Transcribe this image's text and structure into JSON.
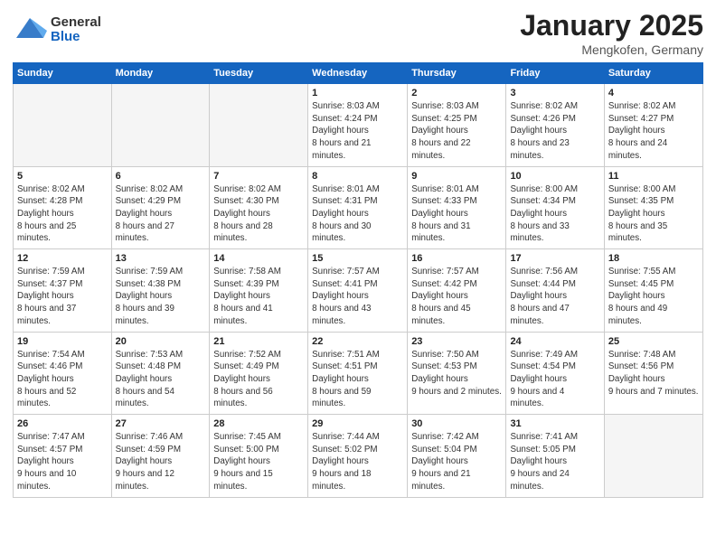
{
  "header": {
    "logo_general": "General",
    "logo_blue": "Blue",
    "title": "January 2025",
    "location": "Mengkofen, Germany"
  },
  "weekdays": [
    "Sunday",
    "Monday",
    "Tuesday",
    "Wednesday",
    "Thursday",
    "Friday",
    "Saturday"
  ],
  "weeks": [
    [
      {
        "day": "",
        "empty": true
      },
      {
        "day": "",
        "empty": true
      },
      {
        "day": "",
        "empty": true
      },
      {
        "day": "1",
        "sunrise": "8:03 AM",
        "sunset": "4:24 PM",
        "daylight": "8 hours and 21 minutes."
      },
      {
        "day": "2",
        "sunrise": "8:03 AM",
        "sunset": "4:25 PM",
        "daylight": "8 hours and 22 minutes."
      },
      {
        "day": "3",
        "sunrise": "8:02 AM",
        "sunset": "4:26 PM",
        "daylight": "8 hours and 23 minutes."
      },
      {
        "day": "4",
        "sunrise": "8:02 AM",
        "sunset": "4:27 PM",
        "daylight": "8 hours and 24 minutes."
      }
    ],
    [
      {
        "day": "5",
        "sunrise": "8:02 AM",
        "sunset": "4:28 PM",
        "daylight": "8 hours and 25 minutes."
      },
      {
        "day": "6",
        "sunrise": "8:02 AM",
        "sunset": "4:29 PM",
        "daylight": "8 hours and 27 minutes."
      },
      {
        "day": "7",
        "sunrise": "8:02 AM",
        "sunset": "4:30 PM",
        "daylight": "8 hours and 28 minutes."
      },
      {
        "day": "8",
        "sunrise": "8:01 AM",
        "sunset": "4:31 PM",
        "daylight": "8 hours and 30 minutes."
      },
      {
        "day": "9",
        "sunrise": "8:01 AM",
        "sunset": "4:33 PM",
        "daylight": "8 hours and 31 minutes."
      },
      {
        "day": "10",
        "sunrise": "8:00 AM",
        "sunset": "4:34 PM",
        "daylight": "8 hours and 33 minutes."
      },
      {
        "day": "11",
        "sunrise": "8:00 AM",
        "sunset": "4:35 PM",
        "daylight": "8 hours and 35 minutes."
      }
    ],
    [
      {
        "day": "12",
        "sunrise": "7:59 AM",
        "sunset": "4:37 PM",
        "daylight": "8 hours and 37 minutes."
      },
      {
        "day": "13",
        "sunrise": "7:59 AM",
        "sunset": "4:38 PM",
        "daylight": "8 hours and 39 minutes."
      },
      {
        "day": "14",
        "sunrise": "7:58 AM",
        "sunset": "4:39 PM",
        "daylight": "8 hours and 41 minutes."
      },
      {
        "day": "15",
        "sunrise": "7:57 AM",
        "sunset": "4:41 PM",
        "daylight": "8 hours and 43 minutes."
      },
      {
        "day": "16",
        "sunrise": "7:57 AM",
        "sunset": "4:42 PM",
        "daylight": "8 hours and 45 minutes."
      },
      {
        "day": "17",
        "sunrise": "7:56 AM",
        "sunset": "4:44 PM",
        "daylight": "8 hours and 47 minutes."
      },
      {
        "day": "18",
        "sunrise": "7:55 AM",
        "sunset": "4:45 PM",
        "daylight": "8 hours and 49 minutes."
      }
    ],
    [
      {
        "day": "19",
        "sunrise": "7:54 AM",
        "sunset": "4:46 PM",
        "daylight": "8 hours and 52 minutes."
      },
      {
        "day": "20",
        "sunrise": "7:53 AM",
        "sunset": "4:48 PM",
        "daylight": "8 hours and 54 minutes."
      },
      {
        "day": "21",
        "sunrise": "7:52 AM",
        "sunset": "4:49 PM",
        "daylight": "8 hours and 56 minutes."
      },
      {
        "day": "22",
        "sunrise": "7:51 AM",
        "sunset": "4:51 PM",
        "daylight": "8 hours and 59 minutes."
      },
      {
        "day": "23",
        "sunrise": "7:50 AM",
        "sunset": "4:53 PM",
        "daylight": "9 hours and 2 minutes."
      },
      {
        "day": "24",
        "sunrise": "7:49 AM",
        "sunset": "4:54 PM",
        "daylight": "9 hours and 4 minutes."
      },
      {
        "day": "25",
        "sunrise": "7:48 AM",
        "sunset": "4:56 PM",
        "daylight": "9 hours and 7 minutes."
      }
    ],
    [
      {
        "day": "26",
        "sunrise": "7:47 AM",
        "sunset": "4:57 PM",
        "daylight": "9 hours and 10 minutes."
      },
      {
        "day": "27",
        "sunrise": "7:46 AM",
        "sunset": "4:59 PM",
        "daylight": "9 hours and 12 minutes."
      },
      {
        "day": "28",
        "sunrise": "7:45 AM",
        "sunset": "5:00 PM",
        "daylight": "9 hours and 15 minutes."
      },
      {
        "day": "29",
        "sunrise": "7:44 AM",
        "sunset": "5:02 PM",
        "daylight": "9 hours and 18 minutes."
      },
      {
        "day": "30",
        "sunrise": "7:42 AM",
        "sunset": "5:04 PM",
        "daylight": "9 hours and 21 minutes."
      },
      {
        "day": "31",
        "sunrise": "7:41 AM",
        "sunset": "5:05 PM",
        "daylight": "9 hours and 24 minutes."
      },
      {
        "day": "",
        "empty": true
      }
    ]
  ]
}
